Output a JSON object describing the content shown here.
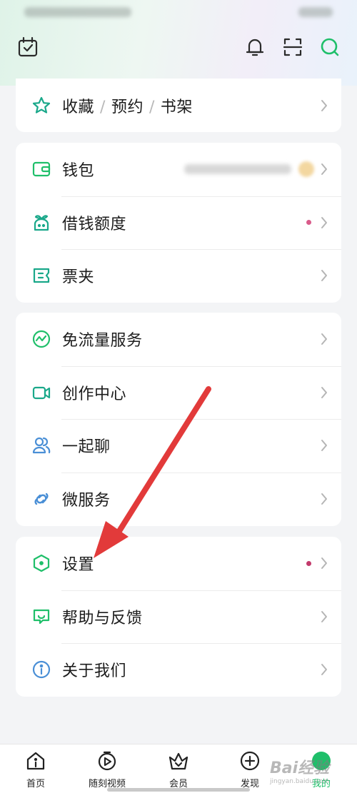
{
  "accent_color": "#1fbf6a",
  "header": {
    "calendar_icon": "calendar-check-icon",
    "bell_icon": "bell-icon",
    "scan_icon": "scan-icon",
    "search_icon": "search-icon"
  },
  "favorites": {
    "label_1": "收藏",
    "sep_1": "/",
    "label_2": "预约",
    "sep_2": "/",
    "label_3": "书架"
  },
  "finance": {
    "wallet": "钱包",
    "borrow": "借钱额度",
    "tickets": "票夹"
  },
  "services": {
    "free_data": "免流量服务",
    "creator": "创作中心",
    "chat": "一起聊",
    "micro": "微服务"
  },
  "misc": {
    "settings": "设置",
    "help": "帮助与反馈",
    "about": "关于我们"
  },
  "status_colors": {
    "dot": "#d43a6a"
  },
  "tabbar": {
    "home": "首页",
    "video": "随刻视频",
    "member": "会员",
    "discover": "发现",
    "mine": "我的"
  },
  "watermark": {
    "main": "Bai经验",
    "sub": "jingyan.baidu.com"
  }
}
